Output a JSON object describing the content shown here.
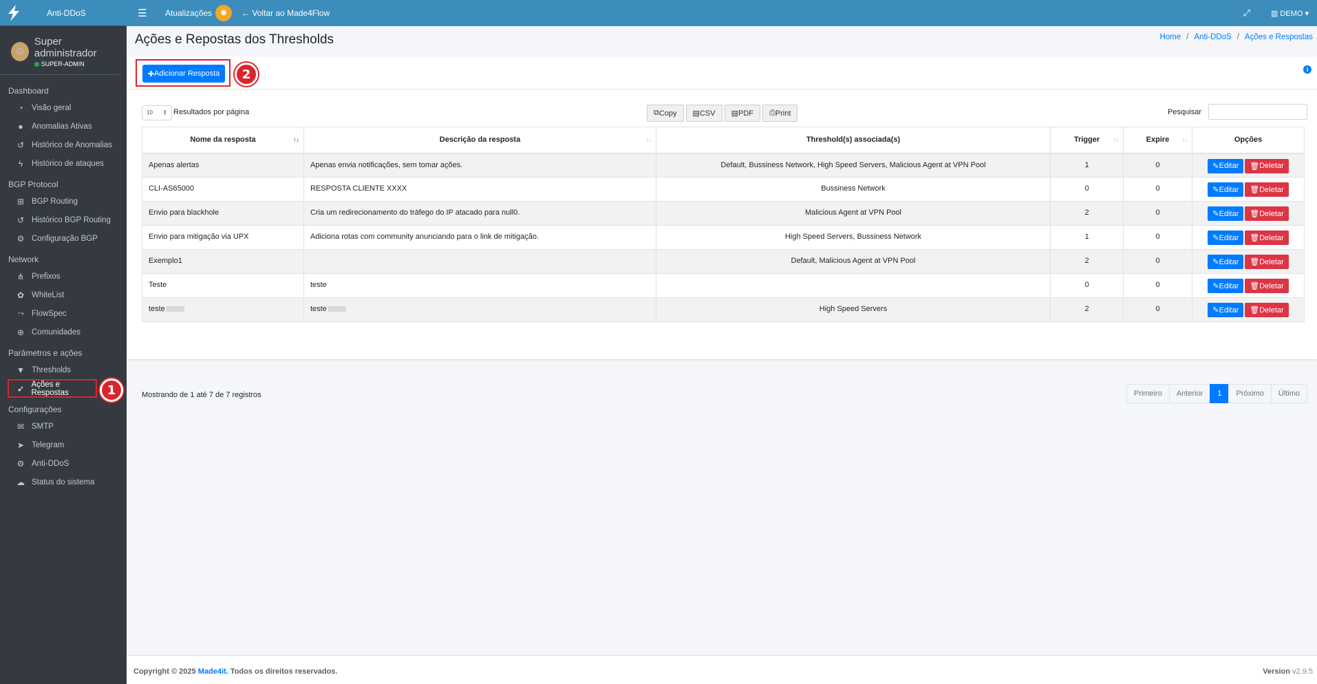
{
  "brand": {
    "title": "Anti-DDoS"
  },
  "user": {
    "name": "Super administrador",
    "role": "SUPER-ADMIN"
  },
  "topbar": {
    "updates": "Atualizações",
    "back": "Voltar ao Made4Flow",
    "account": "DEMO"
  },
  "sidebar": {
    "sections": [
      {
        "label": "Dashboard",
        "items": [
          {
            "icon": "dashboard-icon",
            "label": "Visão geral"
          },
          {
            "icon": "alert-icon",
            "label": "Anomalias Ativas"
          },
          {
            "icon": "history-icon",
            "label": "Histórico de Anomalias"
          },
          {
            "icon": "bolt-icon",
            "label": "Histórico de ataques"
          }
        ]
      },
      {
        "label": "BGP Protocol",
        "items": [
          {
            "icon": "sitemap-icon",
            "label": "BGP Routing"
          },
          {
            "icon": "history-icon",
            "label": "Histórico BGP Routing"
          },
          {
            "icon": "gear-icon",
            "label": "Configuração BGP"
          }
        ]
      },
      {
        "label": "Network",
        "items": [
          {
            "icon": "network-icon",
            "label": "Prefixos"
          },
          {
            "icon": "shield-icon",
            "label": "WhiteList"
          },
          {
            "icon": "flow-icon",
            "label": "FlowSpec"
          },
          {
            "icon": "globe-icon",
            "label": "Comunidades"
          }
        ]
      },
      {
        "label": "Parâmetros e ações",
        "items": [
          {
            "icon": "filter-icon",
            "label": "Thresholds"
          },
          {
            "icon": "rocket-icon",
            "label": "Ações e Respostas"
          }
        ]
      },
      {
        "label": "Configurações",
        "items": [
          {
            "icon": "mail-icon",
            "label": "SMTP"
          },
          {
            "icon": "telegram-icon",
            "label": "Telegram"
          },
          {
            "icon": "gears-icon",
            "label": "Anti-DDoS"
          },
          {
            "icon": "cloud-icon",
            "label": "Status do sistema"
          }
        ]
      }
    ]
  },
  "annotations": {
    "one": "1",
    "two": "2"
  },
  "page": {
    "title": "Ações e Repostas dos Thresholds",
    "breadcrumb": [
      "Home",
      "Anti-DDoS",
      "Ações e Respostas"
    ]
  },
  "card": {
    "add_label": "Adicionar Resposta",
    "length_value": "10",
    "length_label": "Resultados por página",
    "search_label": "Pesquisar",
    "export": [
      "Copy",
      "CSV",
      "PDF",
      "Print"
    ]
  },
  "table": {
    "columns": [
      "Nome da resposta",
      "Descrição da resposta",
      "Threshold(s) associada(s)",
      "Trigger",
      "Expire",
      "Opções"
    ],
    "rows": [
      {
        "name": "Apenas alertas",
        "desc": "Apenas envia notificações, sem tomar ações.",
        "thr": "Default, Bussiness Network, High Speed Servers, Malicious Agent at VPN Pool",
        "trigger": "1",
        "expire": "0"
      },
      {
        "name": "CLI-AS65000",
        "desc": "RESPOSTA CLIENTE XXXX",
        "thr": "Bussiness Network",
        "trigger": "0",
        "expire": "0"
      },
      {
        "name": "Envio para blackhole",
        "desc": "Cria um redirecionamento do tráfego do IP atacado para null0.",
        "thr": "Malicious Agent at VPN Pool",
        "trigger": "2",
        "expire": "0"
      },
      {
        "name": "Envio para mitigação via UPX",
        "desc": "Adiciona rotas com community anunciando para o link de mitigação.",
        "thr": "High Speed Servers, Bussiness Network",
        "trigger": "1",
        "expire": "0"
      },
      {
        "name": "Exemplo1",
        "desc": "",
        "thr": "Default, Malicious Agent at VPN Pool",
        "trigger": "2",
        "expire": "0"
      },
      {
        "name": "Teste",
        "desc": "teste",
        "thr": "",
        "trigger": "0",
        "expire": "0"
      },
      {
        "name": "teste",
        "desc": "teste",
        "thr": "High Speed Servers",
        "trigger": "2",
        "expire": "0"
      }
    ],
    "edit_label": "Editar",
    "delete_label": "Deletar"
  },
  "info": "Mostrando de 1 até 7 de 7 registros",
  "pager": [
    "Primeiro",
    "Anterior",
    "1",
    "Próximo",
    "Último"
  ],
  "footer": {
    "copyright": "Copyright © 2025",
    "company": "Made4it.",
    "rights": "Todos os direitos reservados.",
    "version_label": "Version",
    "version": "v2.9.5"
  },
  "colors": {
    "accent": "#3c8dbc",
    "primary": "#007bff",
    "danger": "#dc3545",
    "sidebar": "#343a40",
    "highlight": "#d9262c"
  }
}
